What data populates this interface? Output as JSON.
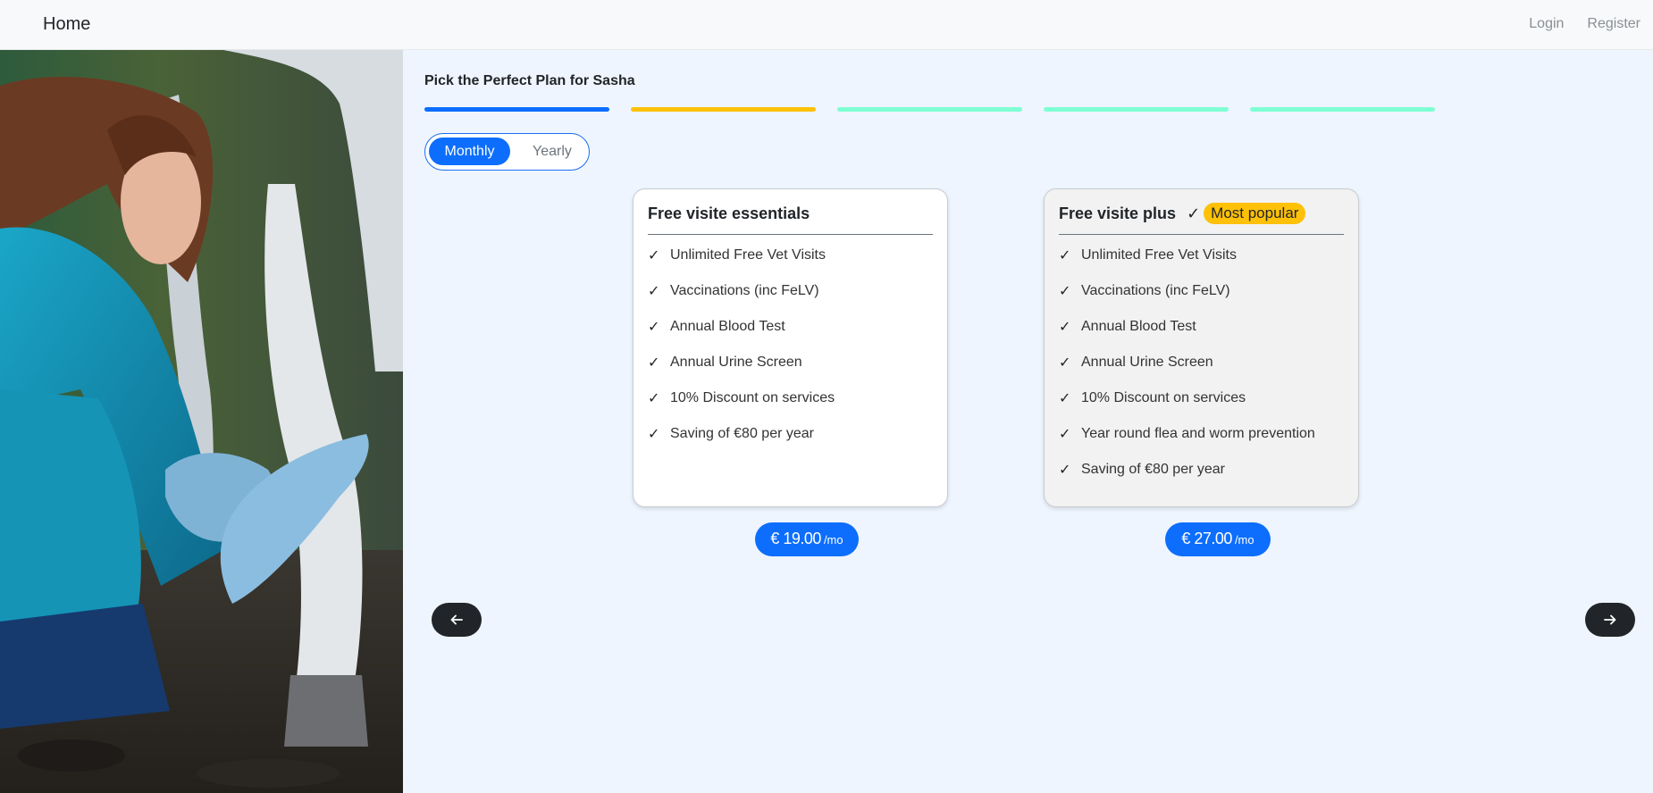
{
  "nav": {
    "brand": "Home",
    "login": "Login",
    "register": "Register"
  },
  "hero": {
    "alt": "Veterinarian examining a white horse's leg"
  },
  "step": {
    "title": "Pick the Perfect Plan for Sasha",
    "progress_colors": [
      "#0d6efd",
      "#fec107",
      "#7fffd4",
      "#7fffd4",
      "#7fffd4"
    ]
  },
  "billing": {
    "monthly": "Monthly",
    "yearly": "Yearly",
    "selected": "Monthly"
  },
  "plans": [
    {
      "name": "Free visite essentials",
      "features": [
        "Unlimited Free Vet Visits",
        "Vaccinations (inc FeLV)",
        "Annual Blood Test",
        "Annual Urine Screen",
        "10% Discount on services",
        "Saving of €80 per year"
      ],
      "price": "€ 19.00",
      "period": "/mo"
    },
    {
      "name": "Free visite plus",
      "badge": "Most popular",
      "features": [
        "Unlimited Free Vet Visits",
        "Vaccinations (inc FeLV)",
        "Annual Blood Test",
        "Annual Urine Screen",
        "10% Discount on services",
        "Year round flea and worm prevention",
        "Saving of €80 per year"
      ],
      "price": "€ 27.00",
      "period": "/mo"
    }
  ],
  "icons": {
    "check": "check-icon",
    "prev": "arrow-left-icon",
    "next": "arrow-right-icon"
  }
}
